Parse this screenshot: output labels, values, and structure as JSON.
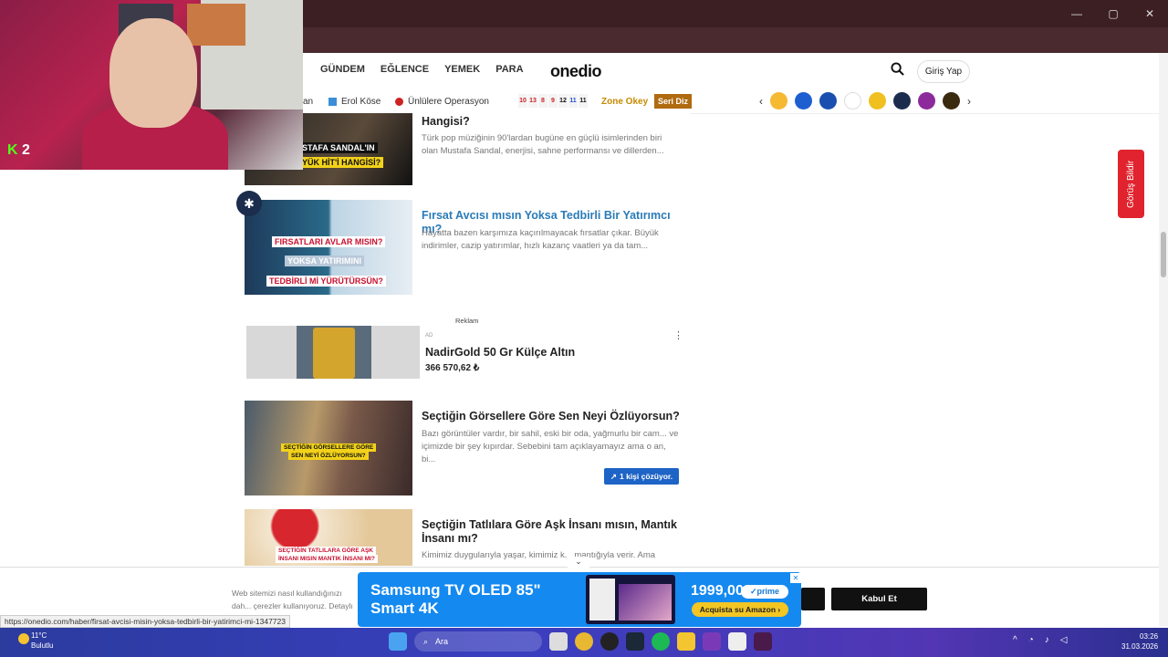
{
  "window": {
    "controls": [
      "—",
      "▢",
      "✕"
    ],
    "bar_icons": [
      "⧉",
      "☆",
      "⬚",
      "⋮"
    ]
  },
  "webcam": {
    "kick_label": "2"
  },
  "header": {
    "nav": [
      "GÜNDEM",
      "EĞLENCE",
      "YEMEK",
      "PARA"
    ],
    "logo": "onedio",
    "search_icon": "search-icon",
    "login": "Giriş Yap"
  },
  "subnav": {
    "partial": "an",
    "erol": "Erol Köse",
    "unlulere": "Ünlülere Operasyon",
    "numbers": [
      "10",
      "13",
      "8",
      "9",
      "12",
      "11",
      "11"
    ],
    "zone": "Zone Okey",
    "seri": "Seri Diz"
  },
  "feedback": "Görüş Bildir",
  "cards": [
    {
      "title": "Hangisi?",
      "desc": "Türk pop müziğinin 90'lardan bugüne en güçlü isimlerinden biri olan Mustafa Sandal, enerjisi, sahne performansı ve dillerden...",
      "thumb_text": [
        "STAFA SANDAL'IN",
        "YÜK HİT'İ HANGİSİ?"
      ]
    },
    {
      "title": "Fırsat Avcısı mısın Yoksa Tedbirli Bir Yatırımcı mı?",
      "desc": "Hayatta bazen karşımıza kaçırılmayacak fırsatlar çıkar. Büyük indirimler, cazip yatırımlar, hızlı kazanç vaatleri ya da tam...",
      "thumb_text": [
        "FIRSATLARI AVLAR MISIN?",
        "YOKSA YATIRIMINI",
        "TEDBİRLİ Mİ YÜRÜTÜRSÜN?"
      ]
    },
    {
      "title": "Seçtiğin Görsellere Göre Sen Neyi Özlüyorsun?",
      "desc": "Bazı görüntüler vardır, bir sahil, eski bir oda, yağmurlu bir cam... ve içimizde bir şey kıpırdar. Sebebini tam açıklayamayız ama o an, bi...",
      "thumb_text": [
        "SEÇTİĞİN GÖRSELLERE GÖRE",
        "SEN NEYİ ÖZLÜYORSUN?"
      ],
      "badge": "1 kişi çözüyor."
    },
    {
      "title": "Seçtiğin Tatlılara Göre Aşk İnsanı mısın, Mantık İnsanı mı?",
      "desc": "Kimimiz duygularıyla yaşar, kimimiz k... mantığıyla verir. Ama",
      "thumb_text": [
        "SEÇTİĞİN TATLILARA GÖRE AŞK",
        "İNSANI MISIN MANTIK İNSANI MI?"
      ]
    }
  ],
  "ad": {
    "label": "Reklam",
    "tag": "AD",
    "name": "NadirGold 50 Gr Külçe Altın",
    "price": "366 570,62 ₺"
  },
  "consent": {
    "text": "Web sitemizi nasıl kullandığınızı dah... çerezler kullanıyoruz. Detaylı bilgi iç...",
    "accept": "Kabul Et"
  },
  "samsung_ad": {
    "headline": "Samsung TV OLED 85\" Smart 4K",
    "price": "1999,00€",
    "prime": "✓prime",
    "cta": "Acquista su Amazon  ›"
  },
  "status_url": "https://onedio.com/haber/firsat-avcisi-misin-yoksa-tedbirli-bir-yatirimci-mi-1347723",
  "taskbar": {
    "temp": "11°C",
    "condition": "Bulutlu",
    "search": "Ara",
    "time": "03:26",
    "date": "31.03.2026"
  },
  "colors": {
    "accent": "#1e63c6",
    "feedback": "#e0232e",
    "seri": "#b06a10",
    "zone": "#c58a00"
  }
}
